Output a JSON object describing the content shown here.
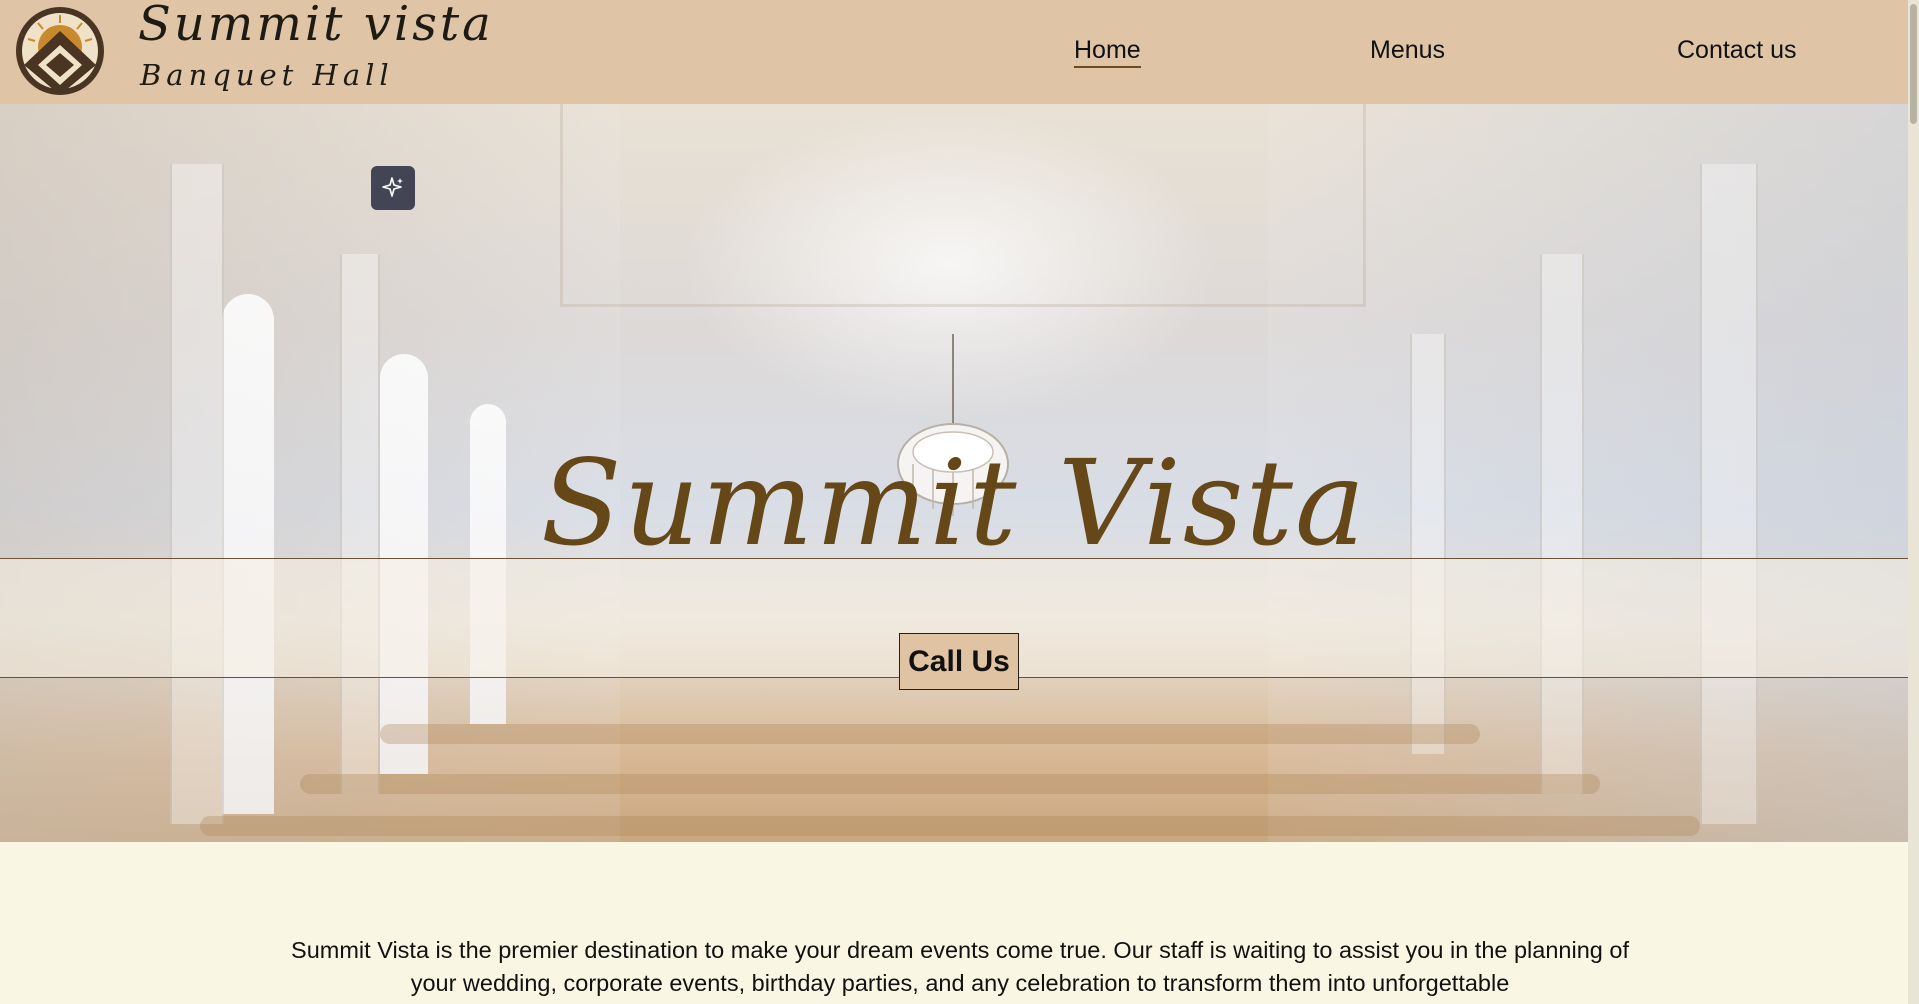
{
  "brand": {
    "name": "Summit vista",
    "subtitle": "Banquet Hall"
  },
  "nav": {
    "items": [
      {
        "label": "Home",
        "active": true
      },
      {
        "label": "Menus",
        "active": false
      },
      {
        "label": "Contact us",
        "active": false
      }
    ]
  },
  "hero": {
    "title": "Summit Vista",
    "cta_label": "Call Us",
    "sparkle_icon": "sparkle-icon"
  },
  "intro": {
    "text": "Summit Vista is the premier destination to make your dream events come true. Our staff is waiting to assist you in the planning of your wedding, corporate events, birthday parties, and any celebration to transform them into unforgettable"
  },
  "colors": {
    "header_bg": "#dfc5a6",
    "title_brown": "#654718",
    "page_bg": "#f9f7e3",
    "button_bg": "#dfc3a2"
  }
}
